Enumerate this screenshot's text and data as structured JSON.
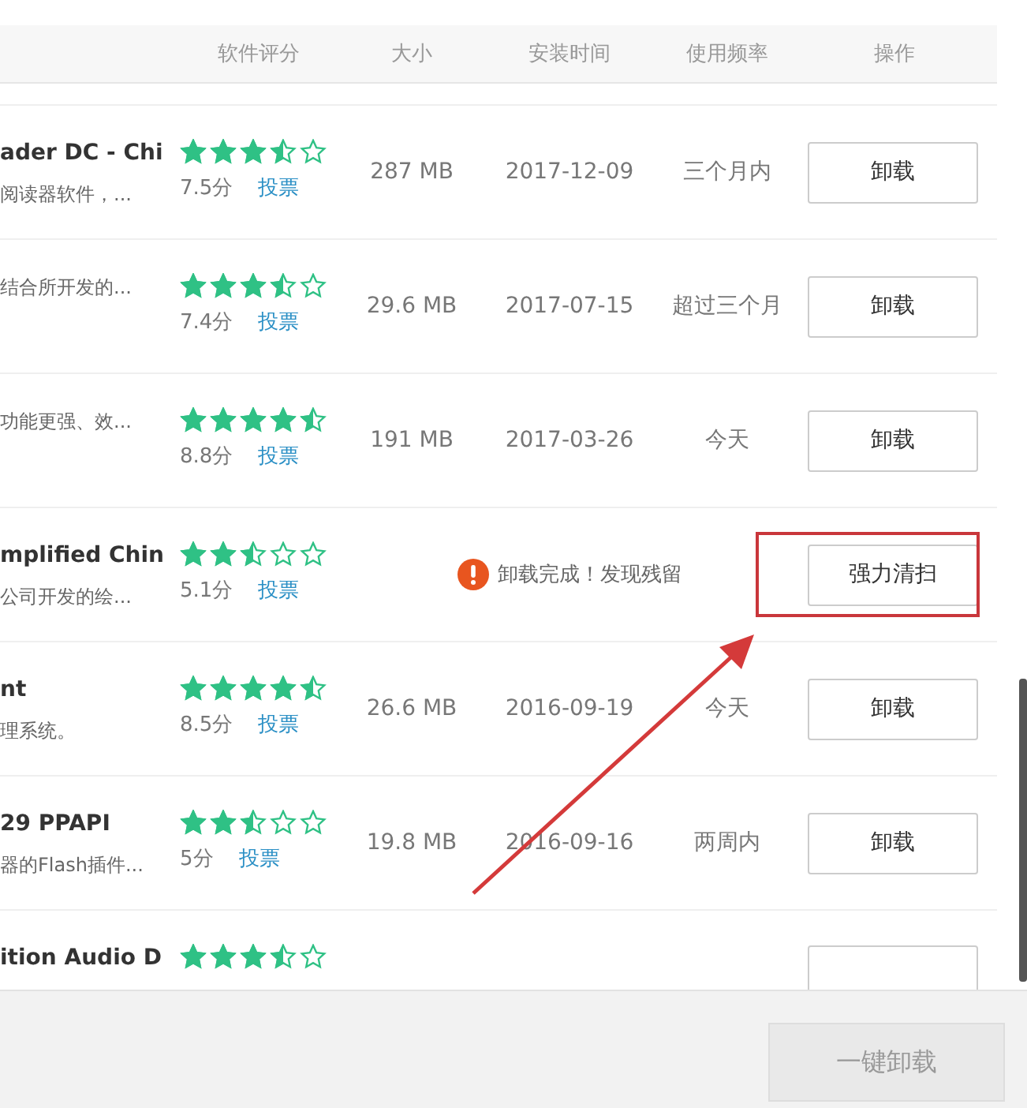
{
  "columns": [
    "软件评分",
    "大小",
    "安装时间",
    "使用频率",
    "操作"
  ],
  "rows": [
    {
      "kind": "normal",
      "name": "ader DC - Chi",
      "description": "阅读器软件，...",
      "stars": 3.5,
      "score": "7.5分",
      "vote": "投票",
      "size": "287 MB",
      "installed": "2017-12-09",
      "frequency": "三个月内",
      "action": "卸载"
    },
    {
      "kind": "normal",
      "description": "结合所开发的...",
      "stars": 3.5,
      "score": "7.4分",
      "vote": "投票",
      "size": "29.6 MB",
      "installed": "2017-07-15",
      "frequency": "超过三个月",
      "action": "卸载"
    },
    {
      "kind": "normal",
      "description": "功能更强、效...",
      "stars": 4.5,
      "score": "8.8分",
      "vote": "投票",
      "size": "191 MB",
      "installed": "2017-03-26",
      "frequency": "今天",
      "action": "卸载"
    },
    {
      "kind": "residue",
      "name": "mplified Chin",
      "description": "公司开发的绘...",
      "stars": 2.5,
      "score": "5.1分",
      "vote": "投票",
      "message": "卸载完成！发现残留",
      "action": "强力清扫",
      "highlighted": true
    },
    {
      "kind": "normal",
      "name": "nt",
      "description": "理系统。",
      "stars": 4.5,
      "score": "8.5分",
      "vote": "投票",
      "size": "26.6 MB",
      "installed": "2016-09-19",
      "frequency": "今天",
      "action": "卸载"
    },
    {
      "kind": "normal",
      "name": "29 PPAPI",
      "description": "器的Flash插件...",
      "stars": 2.5,
      "score": "5分",
      "vote": "投票",
      "size": "19.8 MB",
      "installed": "2016-09-16",
      "frequency": "两周内",
      "action": "卸载"
    },
    {
      "kind": "normal",
      "name": "ition Audio D",
      "stars": 3.5
    }
  ],
  "footer": {
    "button": "一键卸载"
  }
}
